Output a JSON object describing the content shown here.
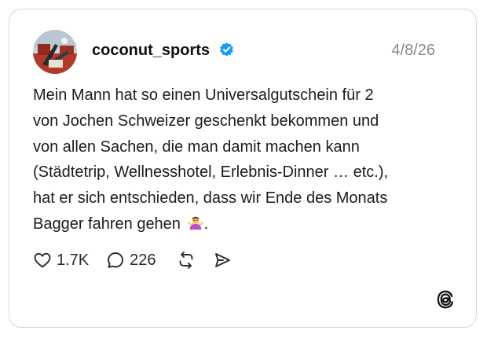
{
  "post": {
    "username": "coconut_sports",
    "verified": true,
    "date": "4/8/26",
    "text": "Mein Mann hat so einen Universalgutschein für 2\nvon Jochen Schweizer geschenkt bekommen und\nvon allen Sachen, die man damit machen kann\n(Städtetrip, Wellnesshotel, Erlebnis-Dinner … etc.),\nhat er sich entschieden, dass wir Ende des Monats\nBagger fahren gehen",
    "text_end": ".",
    "emoji": "person-shrugging-emoji"
  },
  "actions": {
    "like_count": "1.7K",
    "reply_count": "226",
    "repost_icon": "repost-icon",
    "share_icon": "send-icon"
  },
  "colors": {
    "verified_badge": "#1d9bf0",
    "date_text": "#8a8a8a",
    "border": "#d6d6d6"
  },
  "brand": {
    "logo": "threads-logo-icon"
  }
}
